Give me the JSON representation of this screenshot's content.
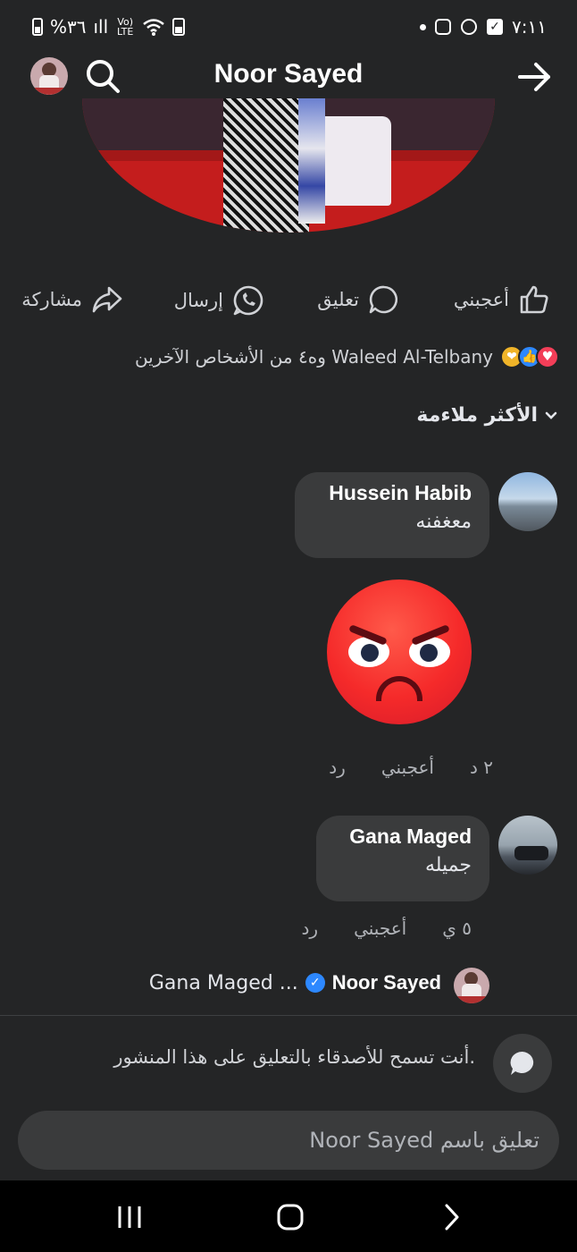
{
  "status_bar": {
    "battery_text": "%٣٦",
    "signal_text": "ıll",
    "volte_text": "Vo) LTE",
    "time": "٧:١١"
  },
  "header": {
    "title": "Noor Sayed"
  },
  "post_actions": {
    "like": "أعجبني",
    "comment": "تعليق",
    "send": "إرسال",
    "share": "مشاركة"
  },
  "reactions": {
    "summary": "Waleed Al-Telbany وه٤ من الأشخاص الآخرين",
    "icons": [
      "heart-react-icon",
      "like-react-icon",
      "care-react-icon"
    ]
  },
  "sort": {
    "label": "الأكثر ملاءمة"
  },
  "comments": [
    {
      "name": "Hussein Habib",
      "text": "معغفنه",
      "time": "٢ د",
      "like": "أعجبني",
      "reply": "رد"
    },
    {
      "name": "Gana Maged",
      "text": "جميله",
      "time": "٥ ي",
      "like": "أعجبني",
      "reply": "رد"
    }
  ],
  "reply_preview": {
    "author": "Noor Sayed",
    "snippet": "Gana Maged ..."
  },
  "notice": {
    "text": "أنت تسمح للأصدقاء بالتعليق على هذا المنشور."
  },
  "composer": {
    "placeholder": "تعليق باسم Noor Sayed"
  },
  "colors": {
    "background": "#242526",
    "bubble": "#3a3b3c",
    "accent_blue": "#2d88ff",
    "angry_red": "#f52a2a"
  }
}
